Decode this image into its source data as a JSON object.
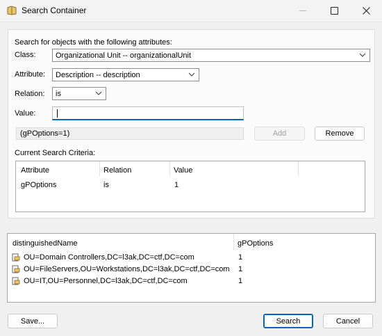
{
  "window": {
    "title": "Search Container"
  },
  "criteria": {
    "heading": "Search for objects with the following attributes:",
    "class_label": "Class:",
    "class_value": "Organizational Unit  --  organizationalUnit",
    "attribute_label": "Attribute:",
    "attribute_value": "Description  --  description",
    "relation_label": "Relation:",
    "relation_value": "is",
    "value_label": "Value:",
    "value_text": "",
    "filter_text": "(gPOptions=1)",
    "add_label": "Add",
    "remove_label": "Remove",
    "current_label": "Current Search Criteria:",
    "columns": [
      "Attribute",
      "Relation",
      "Value"
    ],
    "rows": [
      {
        "attribute": "gPOptions",
        "relation": "is",
        "value": "1"
      }
    ]
  },
  "results": {
    "columns": [
      "distinguishedName",
      "gPOptions"
    ],
    "rows": [
      {
        "dn": "OU=Domain Controllers,DC=l3ak,DC=ctf,DC=com",
        "gpoptions": "1",
        "icon": "ou-icon"
      },
      {
        "dn": "OU=FileServers,OU=Workstations,DC=l3ak,DC=ctf,DC=com",
        "gpoptions": "1",
        "icon": "ou-icon"
      },
      {
        "dn": "OU=IT,OU=Personnel,DC=l3ak,DC=ctf,DC=com",
        "gpoptions": "1",
        "icon": "ou-icon"
      }
    ]
  },
  "buttons": {
    "save": "Save...",
    "search": "Search",
    "cancel": "Cancel"
  },
  "colors": {
    "accent": "#0067c0",
    "window_bg": "#f0f0f0"
  }
}
